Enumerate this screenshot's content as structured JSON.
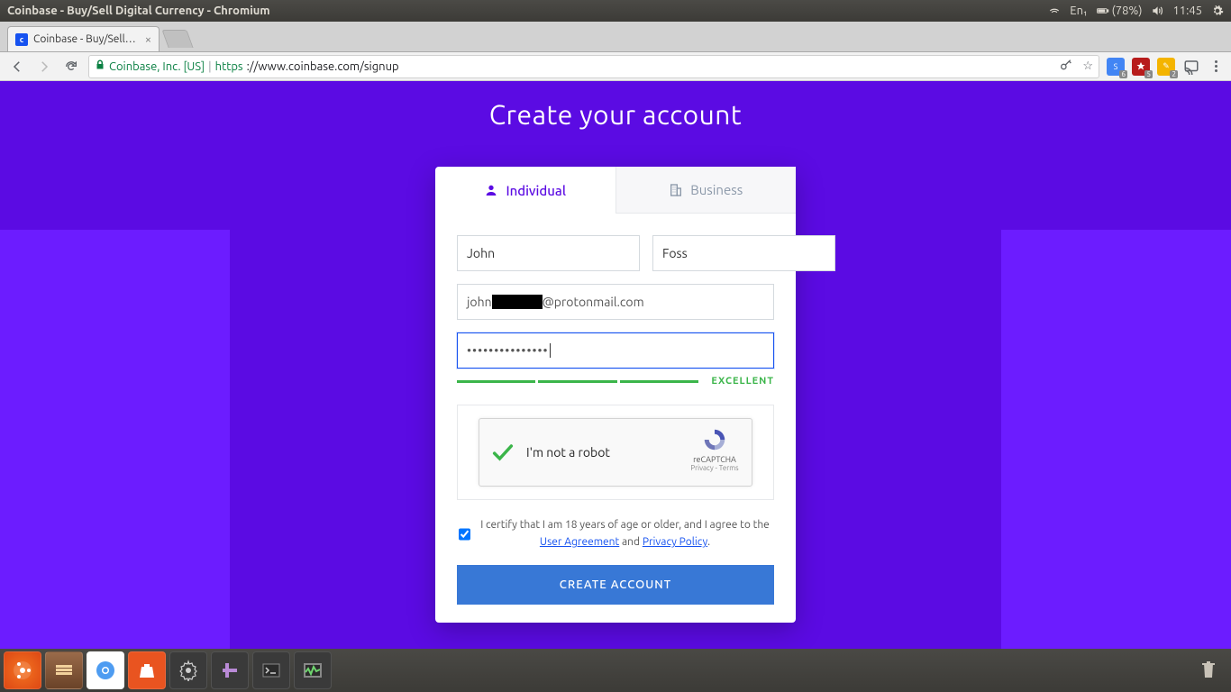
{
  "menubar": {
    "window_title": "Coinbase - Buy/Sell Digital Currency - Chromium",
    "lang": "En₁",
    "battery": "(78%)",
    "time": "11:45"
  },
  "browser": {
    "tab_title": "Coinbase - Buy/Sell…",
    "ev_label": "Coinbase, Inc. [US]",
    "url_secure": "https",
    "url_rest": "://www.coinbase.com/signup",
    "ext_badges": {
      "a": "6",
      "b": "5",
      "c": "2"
    }
  },
  "page": {
    "title": "Create your account",
    "tabs": {
      "individual": "Individual",
      "business": "Business"
    },
    "form": {
      "first_name": "John",
      "last_name": "Foss",
      "email_left": "john",
      "email_right": "@protonmail.com",
      "password": "•••••••••••••••",
      "strength_label": "EXCELLENT"
    },
    "captcha": {
      "label": "I'm not a robot",
      "brand": "reCAPTCHA",
      "links": "Privacy - Terms"
    },
    "certify": {
      "pre": "I certify that I am 18 years of age or older, and I agree to the ",
      "ua": "User Agreement",
      "mid": " and ",
      "pp": "Privacy Policy",
      "post": "."
    },
    "create_button": "CREATE ACCOUNT"
  }
}
